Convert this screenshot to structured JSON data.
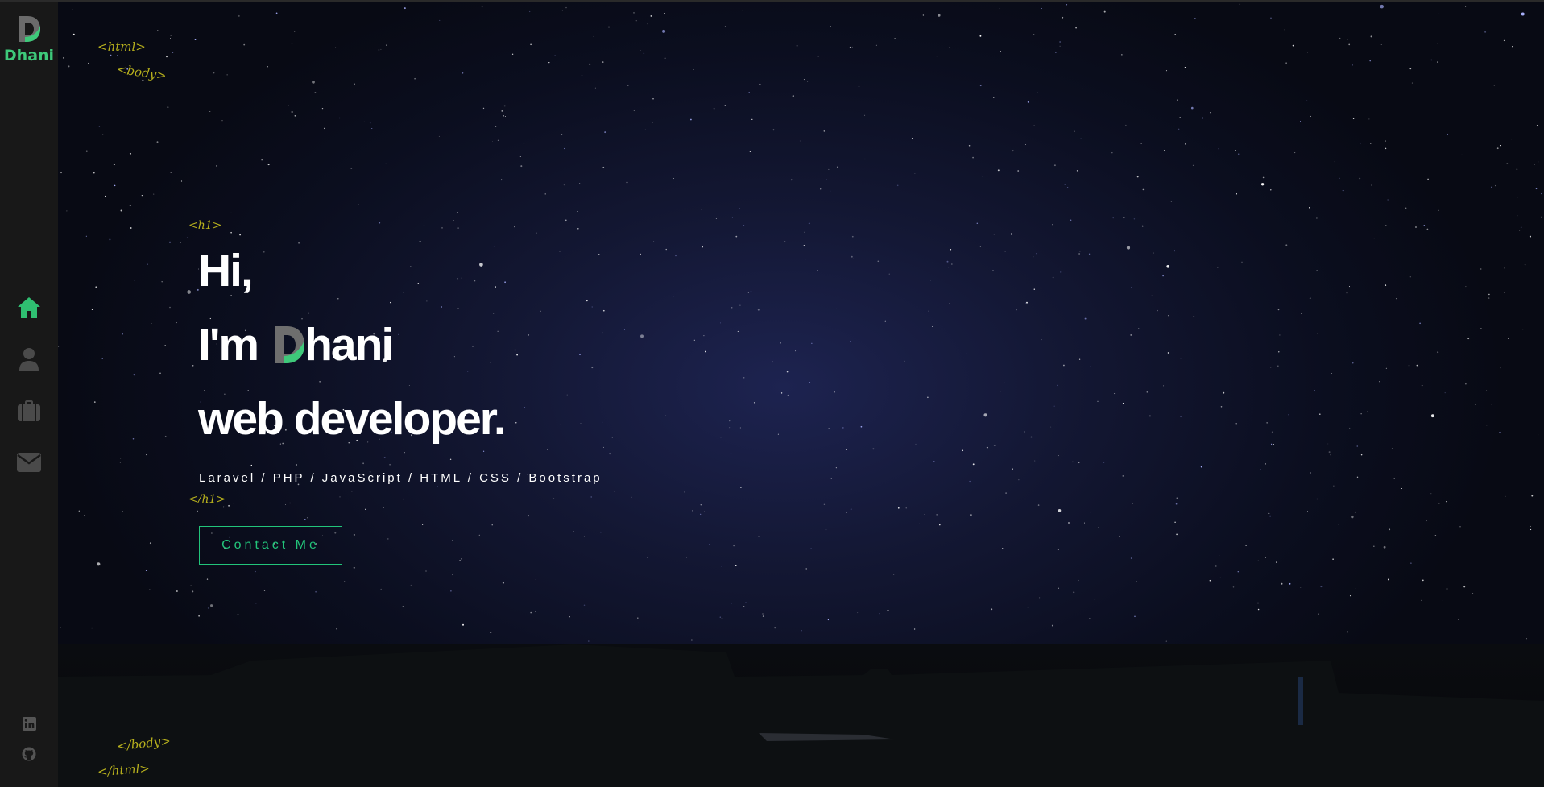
{
  "brand": {
    "logo_text": "Dhani",
    "accent_color": "#3ec97a",
    "button_color": "#22c47a",
    "tag_color": "#b7b01d"
  },
  "nav": {
    "items": [
      {
        "icon": "home-icon",
        "active": true
      },
      {
        "icon": "user-icon",
        "active": false
      },
      {
        "icon": "briefcase-icon",
        "active": false
      },
      {
        "icon": "envelope-icon",
        "active": false
      }
    ],
    "social": [
      {
        "icon": "linkedin-icon"
      },
      {
        "icon": "github-icon"
      }
    ]
  },
  "tags": {
    "html_open": "<html>",
    "body_open": "<body>",
    "h1_open": "<h1>",
    "h1_close": "</h1>",
    "body_close": "</body>",
    "html_close": "</html>"
  },
  "hero": {
    "line1": "Hi,",
    "line2_prefix": "I'm",
    "line2_rest": "hani",
    "line3": "web developer.",
    "skills": "Laravel / PHP / JavaScript / HTML / CSS / Bootstrap",
    "contact_label": "Contact Me"
  }
}
